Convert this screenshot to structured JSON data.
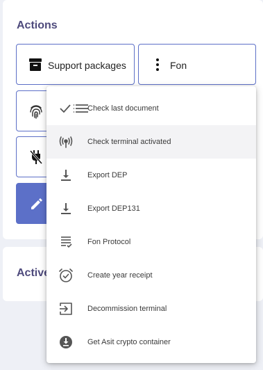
{
  "actions": {
    "title": "Actions",
    "support_label": "Support packages",
    "fon_label": "Fon"
  },
  "active_section": {
    "title": "Active"
  },
  "menu": {
    "items": [
      {
        "label": "Check last document",
        "icon": "check-list-icon"
      },
      {
        "label": "Check terminal activated",
        "icon": "broadcast-icon"
      },
      {
        "label": "Export DEP",
        "icon": "download-icon"
      },
      {
        "label": "Export DEP131",
        "icon": "download-icon"
      },
      {
        "label": "Fon Protocol",
        "icon": "receipt-check-icon"
      },
      {
        "label": "Create year receipt",
        "icon": "alarm-check-icon"
      },
      {
        "label": "Decommission terminal",
        "icon": "exit-icon"
      },
      {
        "label": "Get Asit crypto container",
        "icon": "download-circle-icon"
      }
    ]
  },
  "colors": {
    "accent": "#5c70c8",
    "title": "#4e4a7c",
    "background": "#eef0f6",
    "hover": "#f3f3f5"
  }
}
